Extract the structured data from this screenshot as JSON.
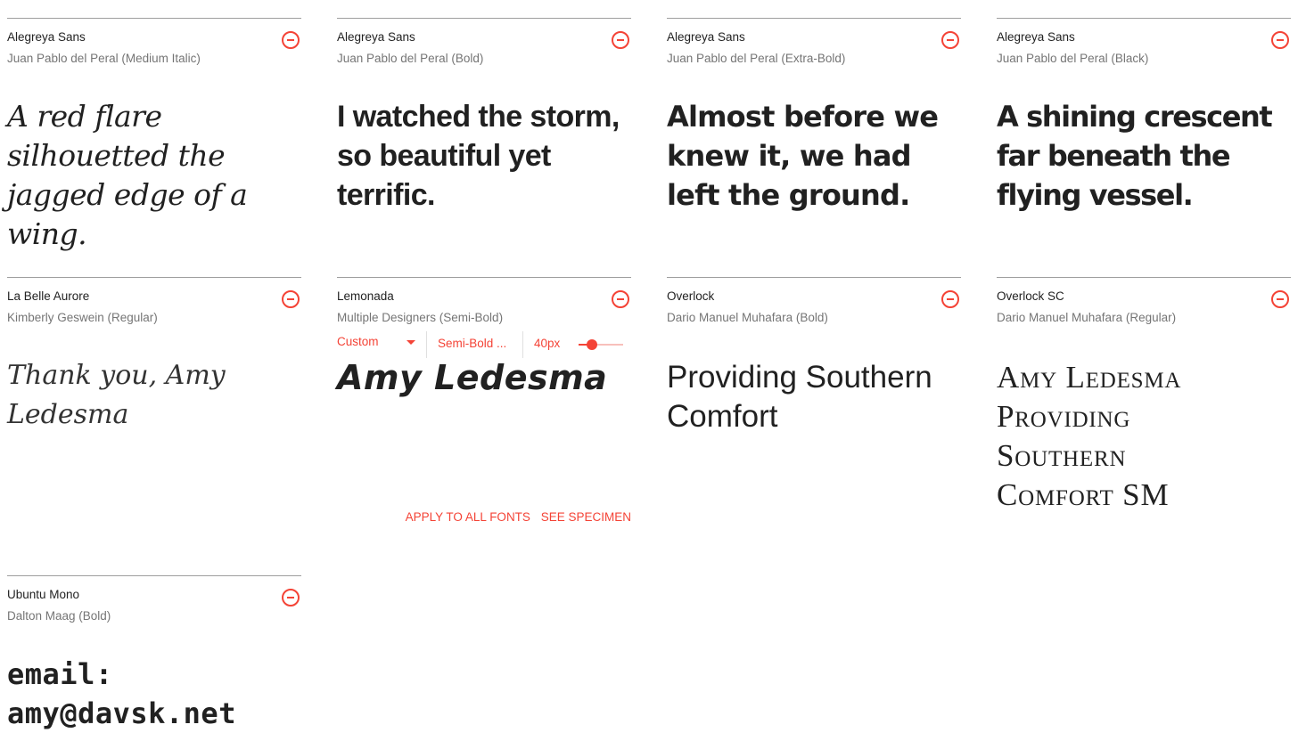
{
  "cards": [
    {
      "family": "Alegreya Sans",
      "designer": "Juan Pablo del Peral (Medium Italic)",
      "sample": "A red flare silhouetted the jagged edge of a wing."
    },
    {
      "family": "Alegreya Sans",
      "designer": "Juan Pablo del Peral (Bold)",
      "sample": "I watched the storm, so beautiful yet terrific."
    },
    {
      "family": "Alegreya Sans",
      "designer": "Juan Pablo del Peral (Extra-Bold)",
      "sample": "Almost before we knew it, we had left the ground."
    },
    {
      "family": "Alegreya Sans",
      "designer": "Juan Pablo del Peral (Black)",
      "sample": "A shining crescent far beneath the flying vessel."
    },
    {
      "family": "La Belle Aurore",
      "designer": "Kimberly Geswein (Regular)",
      "sample": "Thank you, Amy Ledesma"
    },
    {
      "family": "Lemonada",
      "designer": "Multiple Designers (Semi-Bold)",
      "sample": "Amy Ledesma",
      "controls": {
        "sample_type": "Custom",
        "weight": "Semi-Bold ...",
        "size": "40px",
        "size_level": 0.3
      },
      "actions": {
        "apply": "APPLY TO ALL FONTS",
        "specimen": "SEE SPECIMEN"
      }
    },
    {
      "family": "Overlock",
      "designer": "Dario Manuel Muhafara (Bold)",
      "sample": "Providing Southern Comfort"
    },
    {
      "family": "Overlock SC",
      "designer": "Dario Manuel Muhafara (Regular)",
      "sample": "Amy Ledesma Providing Southern Comfort SM"
    },
    {
      "family": "Ubuntu Mono",
      "designer": "Dalton Maag (Bold)",
      "sample": "email: amy@davsk.net"
    }
  ],
  "icons": {
    "remove": "remove-circle-icon",
    "dropdown": "arrow-drop-down-icon"
  },
  "colors": {
    "accent": "#f44336",
    "text": "#212121",
    "secondary_text": "#757575",
    "divider": "#9e9e9e"
  }
}
